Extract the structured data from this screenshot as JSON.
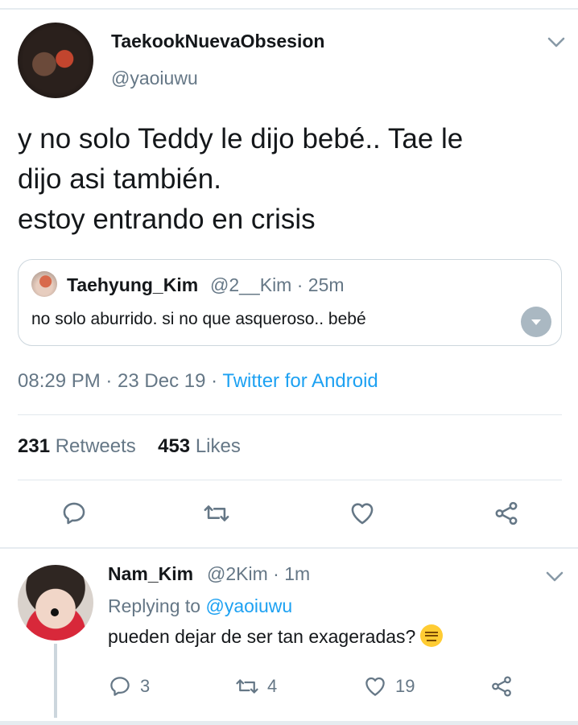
{
  "tweet": {
    "display_name": "TaekookNuevaObsesion",
    "handle": "@yaoiuwu",
    "text_lines": [
      "y no solo Teddy le dijo bebé.. Tae le",
      "dijo asi también.",
      "estoy entrando en crisis"
    ],
    "quoted": {
      "name": "Taehyung_Kim",
      "meta": "@2__Kim · 25m",
      "text": "no solo aburrido. si no que asqueroso.. bebé"
    },
    "timestamp": "08:29 PM · 23 Dec 19 · ",
    "via": "Twitter for Android",
    "retweets_count": "231",
    "retweets_label": "Retweets",
    "likes_count": "453",
    "likes_label": "Likes"
  },
  "reply": {
    "name": "Nam_Kim",
    "meta": "@2Kim · 1m",
    "replying_prefix": "Replying to ",
    "replying_to": "@yaoiuwu",
    "text": "pueden dejar de ser tan exageradas?",
    "reply_count": "3",
    "retweet_count": "4",
    "like_count": "19"
  },
  "icons": {
    "reply": "reply-icon",
    "retweet": "retweet-icon",
    "like": "heart-icon",
    "share": "share-icon",
    "menu": "chevron-down-icon"
  },
  "colors": {
    "accent": "#1da1f2",
    "secondary_text": "#657786",
    "primary_text": "#14171a",
    "border": "#e1e8ed"
  }
}
